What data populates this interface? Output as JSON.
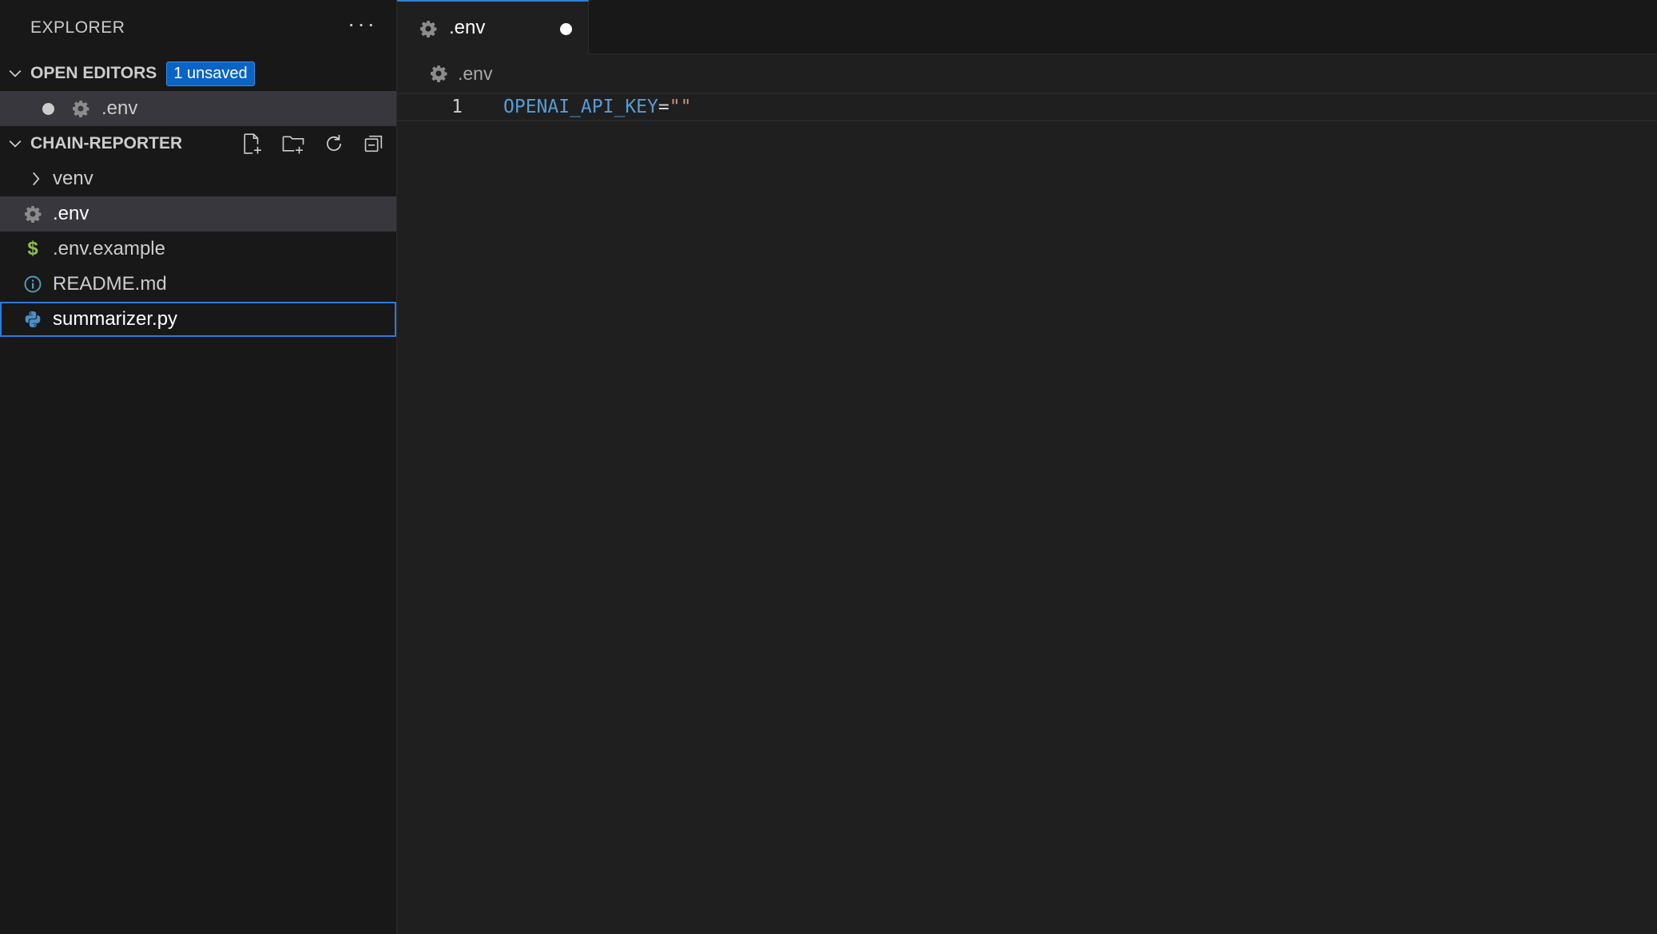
{
  "explorer": {
    "title": "EXPLORER",
    "more_label": "···"
  },
  "open_editors": {
    "label": "OPEN EDITORS",
    "badge": "1 unsaved",
    "items": [
      {
        "name": ".env",
        "icon": "gear-icon",
        "dirty": true
      }
    ]
  },
  "project": {
    "label": "CHAIN-REPORTER",
    "actions": [
      "new-file-icon",
      "new-folder-icon",
      "refresh-icon",
      "collapse-all-icon"
    ],
    "items": [
      {
        "name": "venv",
        "type": "folder",
        "icon": "chevron-right-icon"
      },
      {
        "name": ".env",
        "type": "file",
        "icon": "gear-icon"
      },
      {
        "name": ".env.example",
        "type": "file",
        "icon": "dollar-icon"
      },
      {
        "name": "README.md",
        "type": "file",
        "icon": "info-icon"
      },
      {
        "name": "summarizer.py",
        "type": "file",
        "icon": "python-icon"
      }
    ]
  },
  "editor": {
    "tab": {
      "label": ".env",
      "icon": "gear-icon",
      "dirty": true
    },
    "breadcrumb": ".env",
    "lines": [
      {
        "number": "1",
        "key": "OPENAI_API_KEY",
        "eq": "=",
        "value": "\"\""
      }
    ]
  },
  "colors": {
    "accent": "#2f7fd6",
    "badge": "#0a64c5",
    "dollar_icon": "#8dc149",
    "python_icon": "#4d8ec5",
    "info_icon": "#519aba"
  }
}
